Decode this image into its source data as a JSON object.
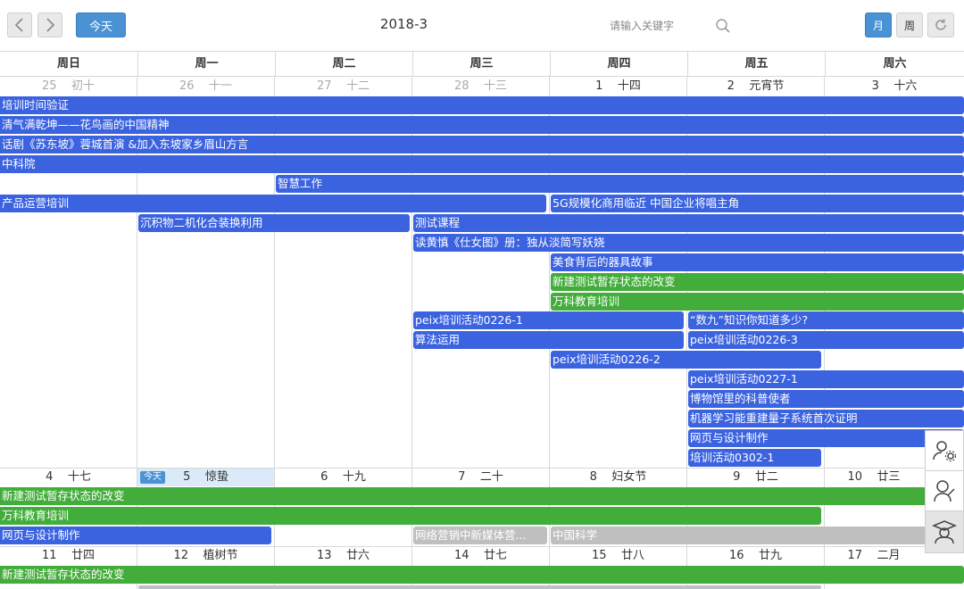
{
  "toolbar": {
    "today_label": "今天",
    "title": "2018-3",
    "search_placeholder": "请输入关键字",
    "month_label": "月",
    "week_label": "周"
  },
  "weekdays": [
    "周日",
    "周一",
    "周二",
    "周三",
    "周四",
    "周五",
    "周六"
  ],
  "weeks": [
    {
      "days": [
        {
          "num": "25",
          "lunar": "初十"
        },
        {
          "num": "26",
          "lunar": "十一"
        },
        {
          "num": "27",
          "lunar": "十二"
        },
        {
          "num": "28",
          "lunar": "十三"
        },
        {
          "num": "1",
          "lunar": "十四"
        },
        {
          "num": "2",
          "lunar": "元宵节"
        },
        {
          "num": "3",
          "lunar": "十六"
        }
      ]
    },
    {
      "days": [
        {
          "num": "4",
          "lunar": "十七"
        },
        {
          "num": "5",
          "lunar": "惊蛰",
          "today_tag": "今天"
        },
        {
          "num": "6",
          "lunar": "十九"
        },
        {
          "num": "7",
          "lunar": "二十"
        },
        {
          "num": "8",
          "lunar": "妇女节"
        },
        {
          "num": "9",
          "lunar": "廿二"
        },
        {
          "num": "10",
          "lunar": "廿三"
        }
      ]
    },
    {
      "days": [
        {
          "num": "11",
          "lunar": "廿四"
        },
        {
          "num": "12",
          "lunar": "植树节"
        },
        {
          "num": "13",
          "lunar": "廿六"
        },
        {
          "num": "14",
          "lunar": "廿七"
        },
        {
          "num": "15",
          "lunar": "廿八"
        },
        {
          "num": "16",
          "lunar": "廿九"
        },
        {
          "num": "17",
          "lunar": "二月"
        }
      ]
    }
  ],
  "events": [
    {
      "title": "培训时间验证",
      "color": "blue"
    },
    {
      "title": "清气满乾坤——花鸟画的中国精神",
      "color": "blue"
    },
    {
      "title": "话剧《苏东坡》蓉城首演 &加入东坡家乡眉山方言",
      "color": "blue"
    },
    {
      "title": "中科院",
      "color": "blue"
    },
    {
      "title": "智慧工作",
      "color": "blue"
    },
    {
      "title": "产品运营培训",
      "color": "blue"
    },
    {
      "title": "5G规模化商用临近 中国企业将唱主角",
      "color": "blue"
    },
    {
      "title": "沉积物二机化合装换利用",
      "color": "blue"
    },
    {
      "title": "测试课程",
      "color": "blue"
    },
    {
      "title": "读黄慎《仕女图》册：独从淡简写妖娆",
      "color": "blue"
    },
    {
      "title": "美食背后的器具故事",
      "color": "blue"
    },
    {
      "title": "新建测试暂存状态的改变",
      "color": "green"
    },
    {
      "title": "万科教育培训",
      "color": "green"
    },
    {
      "title": "peix培训活动0226-1",
      "color": "blue"
    },
    {
      "title": "“数九”知识你知道多少?",
      "color": "blue"
    },
    {
      "title": "算法运用",
      "color": "blue"
    },
    {
      "title": "peix培训活动0226-3",
      "color": "blue"
    },
    {
      "title": "peix培训活动0226-2",
      "color": "blue"
    },
    {
      "title": "peix培训活动0227-1",
      "color": "blue"
    },
    {
      "title": "博物馆里的科普使者",
      "color": "blue"
    },
    {
      "title": "机器学习能重建量子系统首次证明",
      "color": "blue"
    },
    {
      "title": "网页与设计制作",
      "color": "blue"
    },
    {
      "title": "培训活动0302-1",
      "color": "blue"
    },
    {
      "title": "新建测试暂存状态的改变",
      "color": "green"
    },
    {
      "title": "万科教育培训",
      "color": "green"
    },
    {
      "title": "网页与设计制作",
      "color": "blue"
    },
    {
      "title": "网络营销中新媒体营...",
      "color": "gray"
    },
    {
      "title": "中国科学",
      "color": "gray"
    },
    {
      "title": "新建测试暂存状态的改变",
      "color": "green"
    }
  ],
  "side_tools": [
    "user-settings-icon",
    "user-edit-icon",
    "graduate-icon"
  ]
}
